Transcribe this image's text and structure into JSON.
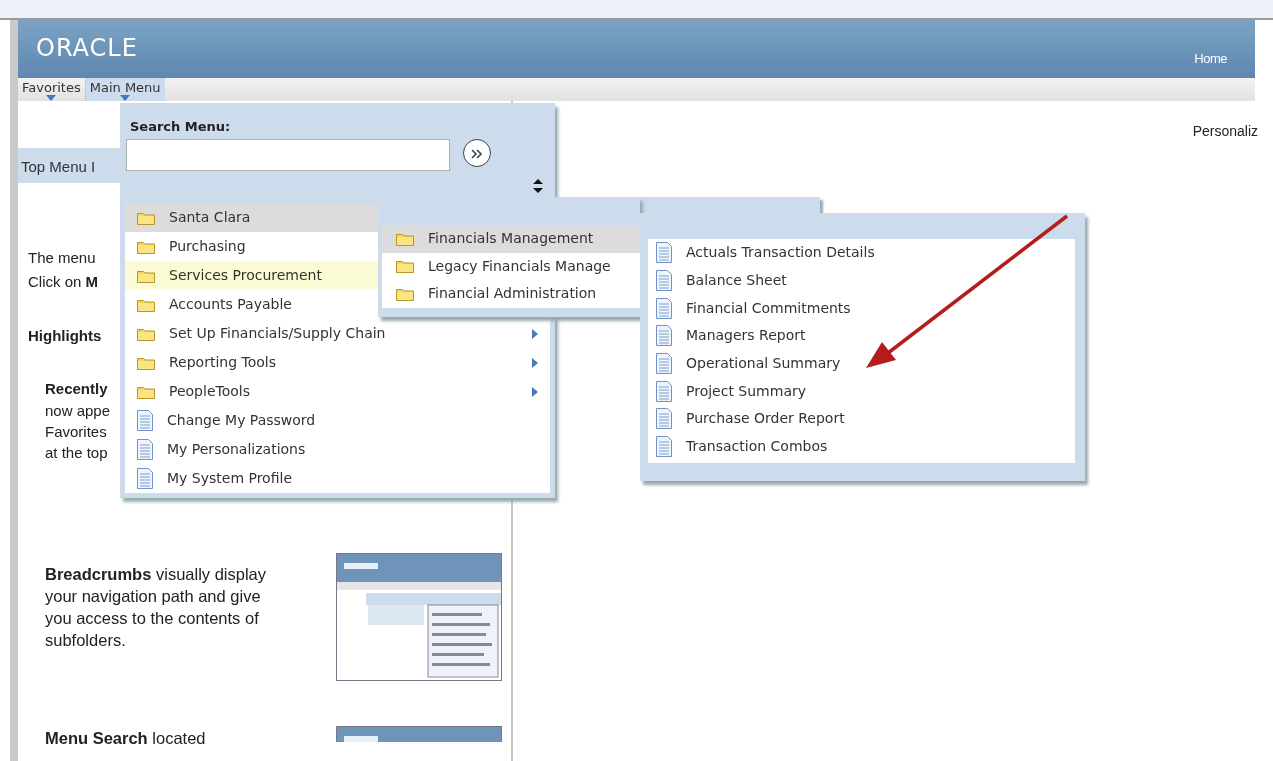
{
  "header": {
    "logo": "ORACLE",
    "links": [
      {
        "label": "Home"
      }
    ]
  },
  "nav": [
    {
      "label": "Favorites",
      "selected": false
    },
    {
      "label": "Main Menu",
      "selected": true
    }
  ],
  "personalize": "Personaliz",
  "left_pane": {
    "title": "Top Menu I",
    "lines": [
      {
        "text": "The menu",
        "kind": "plain"
      },
      {
        "text": "Click on **M**",
        "kind": "plain"
      },
      {
        "text": "Highlights",
        "kind": "heading"
      },
      {
        "text": "Recently",
        "kind": "subheading"
      },
      {
        "text": "now appe",
        "kind": "indented"
      },
      {
        "text": "Favorites",
        "kind": "indented"
      },
      {
        "text": "at the top",
        "kind": "indented"
      }
    ],
    "features": [
      {
        "text": "**Breadcrumbs** visually display your navigation path and give you access to the contents of subfolders."
      },
      {
        "text": "**Menu Search** located"
      }
    ]
  },
  "main_menu": {
    "search_label": "Search Menu:",
    "items": [
      {
        "label": "Santa Clara",
        "kind": "folder",
        "selected": true,
        "hover": false,
        "arrow": false
      },
      {
        "label": "Purchasing",
        "kind": "folder",
        "selected": false,
        "hover": false,
        "arrow": false
      },
      {
        "label": "Services Procurement",
        "kind": "folder",
        "selected": false,
        "hover": true,
        "arrow": false
      },
      {
        "label": "Accounts Payable",
        "kind": "folder",
        "selected": false,
        "hover": false,
        "arrow": false
      },
      {
        "label": "Set Up Financials/Supply Chain",
        "kind": "folder",
        "selected": false,
        "hover": false,
        "arrow": true
      },
      {
        "label": "Reporting Tools",
        "kind": "folder",
        "selected": false,
        "hover": false,
        "arrow": true
      },
      {
        "label": "PeopleTools",
        "kind": "folder",
        "selected": false,
        "hover": false,
        "arrow": true
      },
      {
        "label": "Change My Password",
        "kind": "page",
        "selected": false,
        "hover": false,
        "arrow": false
      },
      {
        "label": "My Personalizations",
        "kind": "page",
        "selected": false,
        "hover": false,
        "arrow": false
      },
      {
        "label": "My System Profile",
        "kind": "page",
        "selected": false,
        "hover": false,
        "arrow": false
      }
    ]
  },
  "submenus": [
    {
      "items": [
        {
          "label": "Financials Management",
          "kind": "folder",
          "selected": true
        },
        {
          "label": "Legacy Financials Manage",
          "kind": "folder",
          "selected": false
        },
        {
          "label": "Financial Administration",
          "kind": "folder",
          "selected": false
        }
      ]
    },
    {
      "items": [
        {
          "label": "Actuals Transaction Details",
          "kind": "page",
          "selected": false
        },
        {
          "label": "Balance Sheet",
          "kind": "page",
          "selected": false
        },
        {
          "label": "Financial Commitments",
          "kind": "page",
          "selected": false
        },
        {
          "label": "Managers Report",
          "kind": "page",
          "selected": false
        },
        {
          "label": "Operational Summary",
          "kind": "page",
          "selected": false
        },
        {
          "label": "Project Summary",
          "kind": "page",
          "selected": false
        },
        {
          "label": "Purchase Order Report",
          "kind": "page",
          "selected": false
        },
        {
          "label": "Transaction Combos",
          "kind": "page",
          "selected": false
        }
      ]
    }
  ]
}
